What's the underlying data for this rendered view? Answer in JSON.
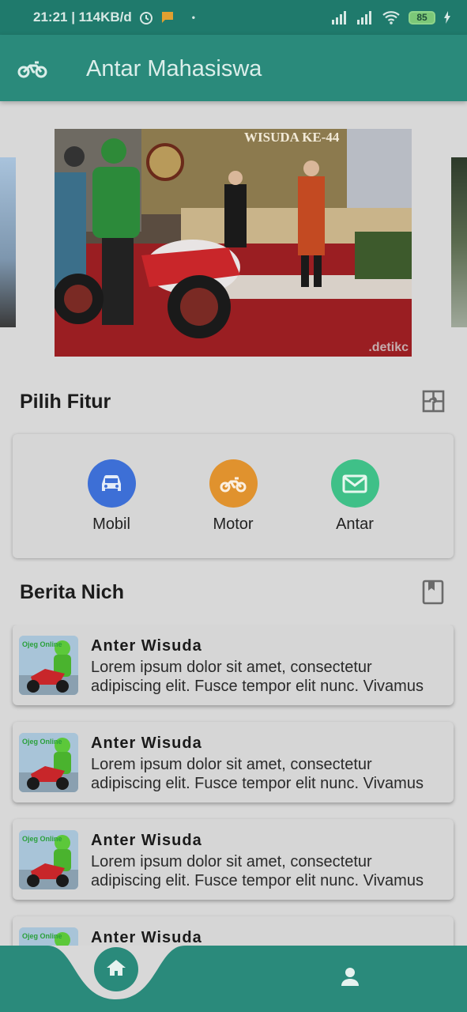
{
  "status_bar": {
    "time_speed": "21:21 | 114KB/d",
    "dot": "•",
    "battery": "85",
    "icons": [
      "alarm-icon",
      "notification-icon",
      "signal-icon",
      "signal-icon",
      "wifi-icon",
      "battery-icon",
      "charging-icon"
    ]
  },
  "app_bar": {
    "title": "Antar Mahasiswa",
    "logo_icon": "motorcycle-icon"
  },
  "carousel": {
    "caption": ".detikc",
    "banner_text": "WISUDA KE-44"
  },
  "features": {
    "title": "Pilih Fitur",
    "header_icon": "puzzle-icon",
    "items": [
      {
        "label": "Mobil",
        "icon": "car-icon",
        "color": "#3d6fd6"
      },
      {
        "label": "Motor",
        "icon": "motorcycle-icon",
        "color": "#e0922e"
      },
      {
        "label": "Antar",
        "icon": "mail-icon",
        "color": "#3fc088"
      }
    ]
  },
  "news": {
    "title": "Berita Nich",
    "header_icon": "bookmark-icon",
    "items": [
      {
        "title": "Anter Wisuda",
        "body": "Lorem ipsum dolor sit amet, consectetur adipiscing elit. Fusce tempor elit nunc. Vivamus",
        "thumb_text": "Ojeg Online"
      },
      {
        "title": "Anter Wisuda",
        "body": "Lorem ipsum dolor sit amet, consectetur adipiscing elit. Fusce tempor elit nunc. Vivamus",
        "thumb_text": "Ojeg Online"
      },
      {
        "title": "Anter Wisuda",
        "body": "Lorem ipsum dolor sit amet, consectetur adipiscing elit. Fusce tempor elit nunc. Vivamus",
        "thumb_text": "Ojeg Online"
      },
      {
        "title": "Anter Wisuda",
        "body": "",
        "thumb_text": "Ojeg Online"
      }
    ]
  },
  "bottom_nav": {
    "items": [
      {
        "icon": "home-icon",
        "active": true
      },
      {
        "icon": "person-icon",
        "active": false
      }
    ]
  },
  "colors": {
    "primary": "#2a8a7b",
    "status_bar": "#1f7a6c",
    "background": "#d8d8d8"
  }
}
